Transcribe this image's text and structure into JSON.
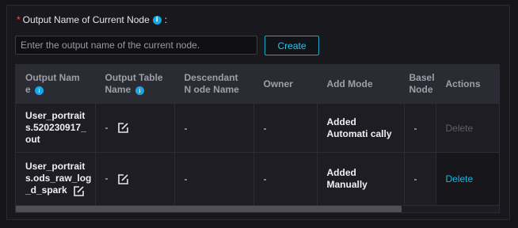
{
  "form": {
    "required_mark": "*",
    "label": "Output Name of Current Node",
    "info_glyph": "i",
    "colon": ":",
    "input_value": "",
    "input_placeholder": "Enter the output name of the current node.",
    "create_label": "Create"
  },
  "table": {
    "headers": {
      "output_name": "Output Nam e",
      "output_table_name": "Output Table Name",
      "descendant": "Descendant N ode Name",
      "owner": "Owner",
      "add_mode": "Add Mode",
      "baseline": "Basel Node",
      "actions": "Actions"
    },
    "rows": [
      {
        "output_name": "User_portrait s.520230917_ out",
        "output_table_name": "-",
        "descendant": "-",
        "owner": "-",
        "add_mode": "Added Automati cally",
        "baseline": "-",
        "action": "Delete",
        "action_enabled": false
      },
      {
        "output_name": "User_portrait s.ods_raw_log _d_spark",
        "output_table_name": "-",
        "descendant": "-",
        "owner": "-",
        "add_mode": "Added Manually",
        "baseline": "-",
        "action": "Delete",
        "action_enabled": true
      }
    ]
  },
  "icons": {
    "info": "info-icon",
    "edit": "edit-icon"
  },
  "colors": {
    "accent": "#1cb3e0",
    "required": "#ff4d4f",
    "disabled_text": "#5f6068"
  }
}
